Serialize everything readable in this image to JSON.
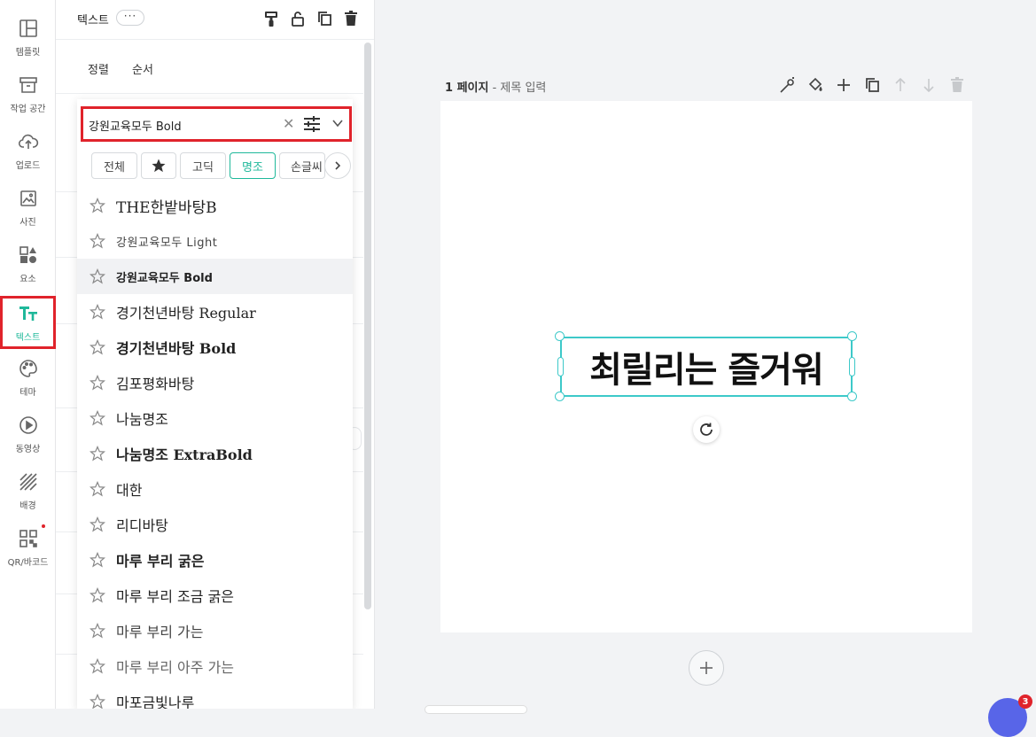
{
  "rail": {
    "items": [
      {
        "label": "템플릿",
        "icon": "template-icon"
      },
      {
        "label": "작업 공간",
        "icon": "workspace-icon"
      },
      {
        "label": "업로드",
        "icon": "upload-icon"
      },
      {
        "label": "사진",
        "icon": "photo-icon"
      },
      {
        "label": "요소",
        "icon": "elements-icon"
      },
      {
        "label": "텍스트",
        "icon": "text-icon",
        "active": true
      },
      {
        "label": "테마",
        "icon": "palette-icon"
      },
      {
        "label": "동영상",
        "icon": "video-icon"
      },
      {
        "label": "배경",
        "icon": "background-icon"
      },
      {
        "label": "QR/바코드",
        "icon": "qr-icon"
      }
    ]
  },
  "panel": {
    "title": "텍스트",
    "more_label": "···",
    "subtabs": [
      "정렬",
      "순서"
    ]
  },
  "font_picker": {
    "search_value": "강원교육모두 Bold",
    "categories": [
      {
        "label": "전체"
      },
      {
        "label": "★",
        "icon": "star-filled-icon"
      },
      {
        "label": "고딕"
      },
      {
        "label": "명조",
        "selected": true
      },
      {
        "label": "손글씨"
      }
    ],
    "fonts": [
      {
        "name": "THE한밭바탕B"
      },
      {
        "name": "강원교육모두 Light"
      },
      {
        "name": "강원교육모두 Bold",
        "highlighted": true
      },
      {
        "name": "경기천년바탕 Regular"
      },
      {
        "name": "경기천년바탕 Bold"
      },
      {
        "name": "김포평화바탕"
      },
      {
        "name": "나눔명조"
      },
      {
        "name": "나눔명조 ExtraBold"
      },
      {
        "name": "대한"
      },
      {
        "name": "리디바탕"
      },
      {
        "name": "마루 부리 굵은"
      },
      {
        "name": "마루 부리 조금 굵은"
      },
      {
        "name": "마루 부리 가는"
      },
      {
        "name": "마루 부리 아주 가는"
      },
      {
        "name": "마포금빛나루"
      }
    ]
  },
  "canvas": {
    "page_number": "1 페이지",
    "page_title_placeholder": "제목 입력",
    "page_separator": " - ",
    "text_content": "최릴리는 즐거워",
    "badge_count": "3"
  },
  "colors": {
    "accent": "#1fb89a",
    "selection": "#3dc9c9",
    "highlight_border": "#e0232b",
    "chat": "#5865e8"
  }
}
